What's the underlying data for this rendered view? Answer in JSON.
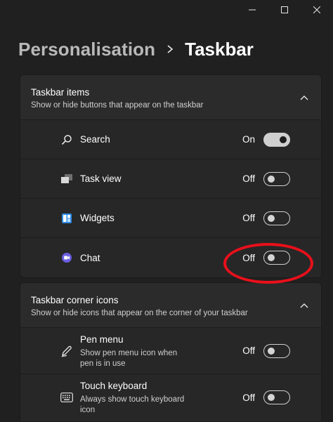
{
  "window": {
    "minimize_icon": "minimize-icon",
    "maximize_icon": "maximize-icon",
    "close_icon": "close-icon"
  },
  "breadcrumb": {
    "parent": "Personalisation",
    "current": "Taskbar"
  },
  "taskbar_items": {
    "title": "Taskbar items",
    "subtitle": "Show or hide buttons that appear on the taskbar",
    "rows": [
      {
        "label": "Search",
        "state": "On",
        "icon": "search-icon"
      },
      {
        "label": "Task view",
        "state": "Off",
        "icon": "task-view-icon"
      },
      {
        "label": "Widgets",
        "state": "Off",
        "icon": "widgets-icon"
      },
      {
        "label": "Chat",
        "state": "Off",
        "icon": "chat-icon"
      }
    ]
  },
  "taskbar_corner_icons": {
    "title": "Taskbar corner icons",
    "subtitle": "Show or hide icons that appear on the corner of your taskbar",
    "rows": [
      {
        "label": "Pen menu",
        "description": "Show pen menu icon when pen is in use",
        "state": "Off",
        "icon": "pen-icon"
      },
      {
        "label": "Touch keyboard",
        "description": "Always show touch keyboard icon",
        "state": "Off",
        "icon": "keyboard-icon"
      }
    ]
  },
  "colors": {
    "background": "#202020",
    "panel": "#2b2b2b",
    "highlight_circle": "#e8101a",
    "widgets_blue": "#2f8ce6",
    "chat_purple": "#6b5fe0"
  }
}
